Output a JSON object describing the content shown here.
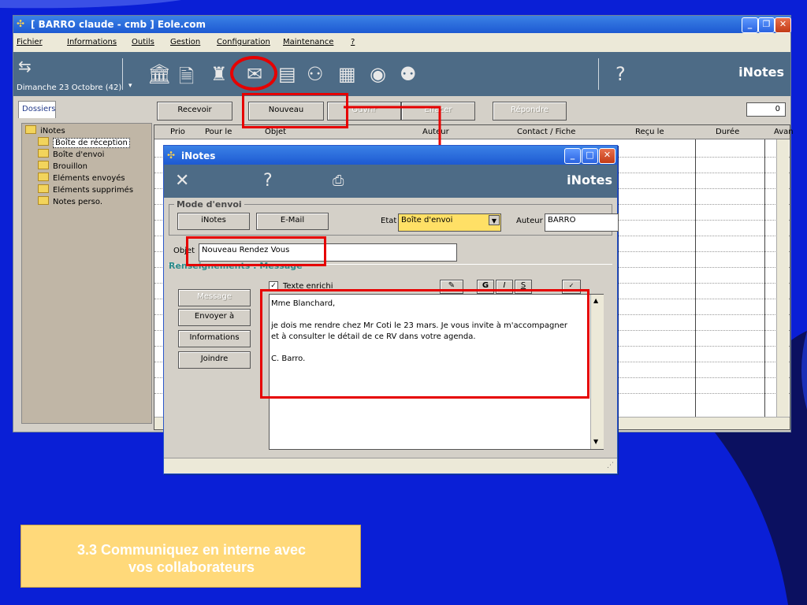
{
  "main_window": {
    "title": "[ BARRO claude - cmb ] Eole.com",
    "menu": [
      "Fichier",
      "Informations",
      "Outils",
      "Gestion",
      "Configuration",
      "Maintenance",
      "?"
    ],
    "date": "Dimanche 23 Octobre (42)",
    "brand": "iNotes",
    "help_glyph": "?"
  },
  "sidebar": {
    "tab": "Dossiers",
    "root": "iNotes",
    "items": [
      {
        "label": "Boîte de réception"
      },
      {
        "label": "Boîte d'envoi"
      },
      {
        "label": "Brouillon"
      },
      {
        "label": "Eléments envoyés"
      },
      {
        "label": "Eléments supprimés"
      },
      {
        "label": "Notes perso."
      }
    ]
  },
  "actions": {
    "recevoir": "Recevoir",
    "nouveau": "Nouveau",
    "ouvrir": "Ouvrir",
    "effacer": "Effacer",
    "repondre": "Répondre",
    "count": "0"
  },
  "grid": {
    "columns": [
      "Prio",
      "Pour le",
      "Objet",
      "Auteur",
      "Contact / Fiche",
      "Reçu le",
      "Durée",
      "Avan"
    ]
  },
  "dialog": {
    "title": "iNotes",
    "brand": "iNotes",
    "help_glyph": "?",
    "mode_legend": "Mode d'envoi",
    "btn_inotes": "iNotes",
    "btn_email": "E-Mail",
    "etat_label": "Etat",
    "etat_value": "Boîte d'envoi",
    "auteur_label": "Auteur",
    "auteur_value": "BARRO",
    "objet_label": "Objet",
    "objet_value": "Nouveau Rendez Vous",
    "info_title": "Renseignements : Message",
    "texte_enrichi": "Texte enrichi",
    "side_buttons": {
      "message": "Message",
      "envoyer": "Envoyer à",
      "informations": "Informations",
      "joindre": "Joindre"
    },
    "message_lines": [
      "Mme Blanchard,",
      "",
      "je dois me rendre chez Mr Coti le 23 mars. Je vous invite à m'accompagner",
      "et à consulter le détail de ce RV dans votre agenda.",
      "",
      "C. Barro."
    ]
  },
  "caption": {
    "line1": "3.3 Communiquez en interne avec",
    "line2": "vos collaborateurs"
  },
  "colors": {
    "slide_bg": "#0a1fd6",
    "highlight": "#e60000",
    "caption_bg": "#ffd97a"
  }
}
